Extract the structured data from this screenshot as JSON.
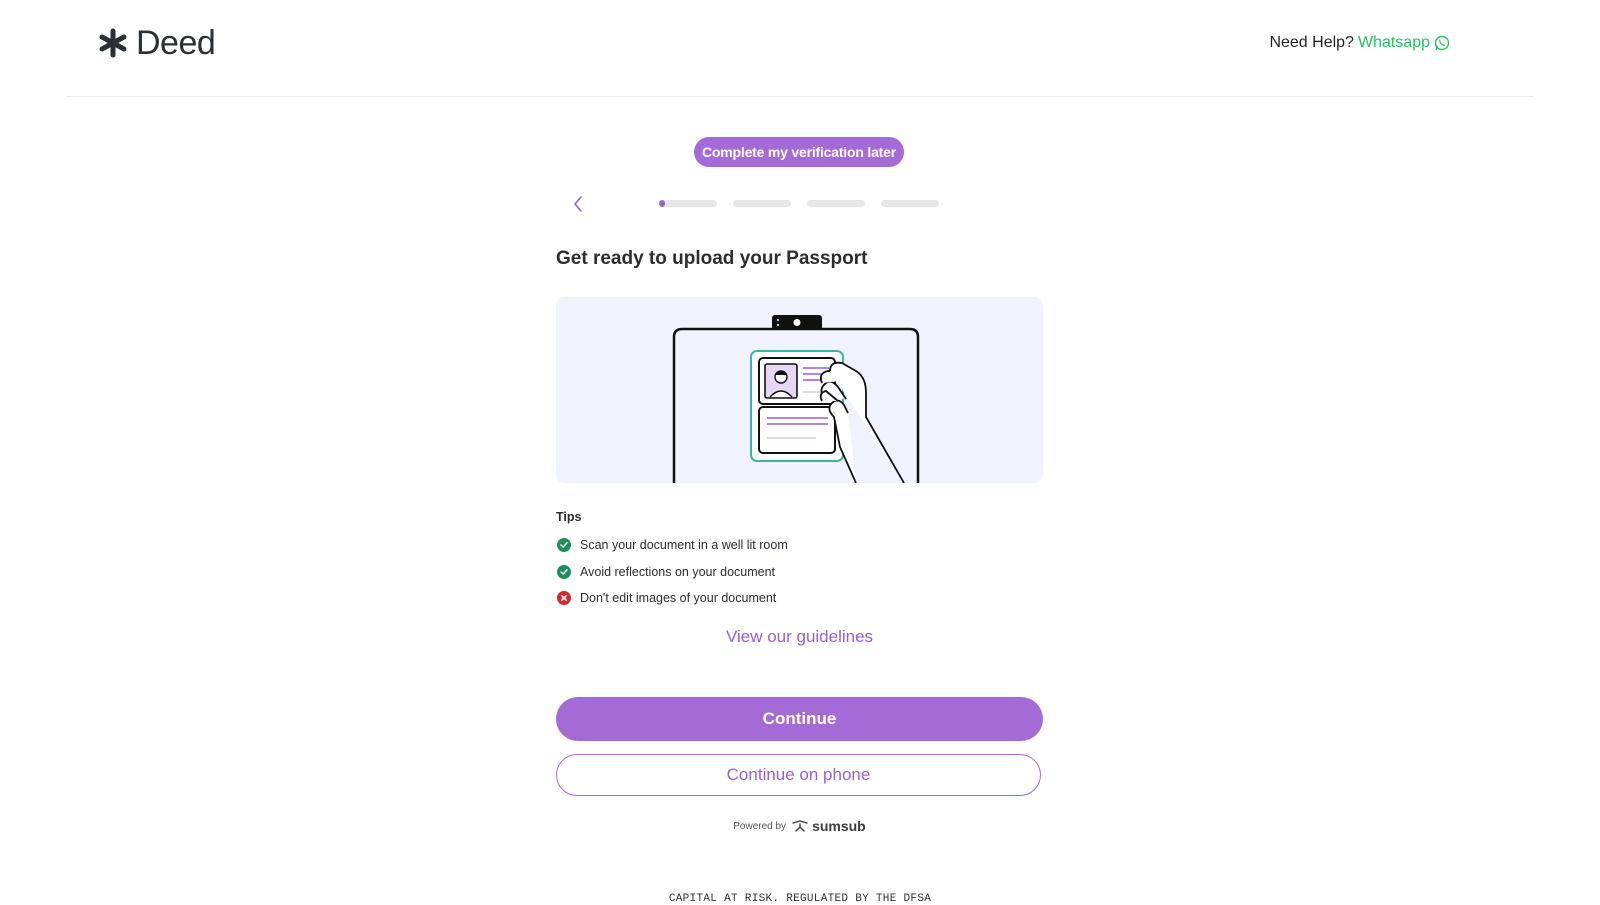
{
  "header": {
    "logo_text": "Deed",
    "help_label": "Need Help?",
    "whatsapp_label": "Whatsapp"
  },
  "verification": {
    "later_button": "Complete my verification later",
    "progress": [
      0.1,
      0,
      0,
      0
    ]
  },
  "main": {
    "title": "Get ready to upload your Passport",
    "tips_title": "Tips",
    "tips": [
      {
        "text": "Scan your document in a well lit room",
        "status": "ok"
      },
      {
        "text": "Avoid reflections on your document",
        "status": "ok"
      },
      {
        "text": "Don't edit images of your document",
        "status": "bad"
      }
    ],
    "guidelines_link": "View our guidelines",
    "continue_button": "Continue",
    "continue_phone_button": "Continue on phone"
  },
  "powered": {
    "label": "Powered by",
    "brand": "sumsub"
  },
  "footer": {
    "text": "CAPITAL AT RISK. REGULATED BY THE DFSA"
  },
  "colors": {
    "accent": "#a46ad6",
    "whatsapp": "#22c55e",
    "ok": "#1f8f5a",
    "error": "#d02b30"
  }
}
